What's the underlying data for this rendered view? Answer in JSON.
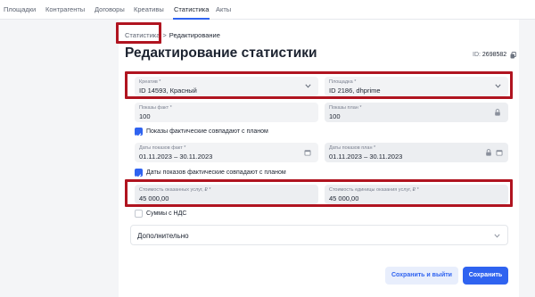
{
  "nav": {
    "items": [
      "Площадки",
      "Контрагенты",
      "Договоры",
      "Креативы",
      "Статистика",
      "Акты"
    ],
    "active_index": 4
  },
  "breadcrumb": {
    "parent": "Статистика",
    "separator": ">",
    "current": "Редактирование"
  },
  "page": {
    "title": "Редактирование статистики",
    "id_label": "ID:",
    "id_value": "2698582"
  },
  "fields": {
    "creative": {
      "label": "Креатив *",
      "value": "ID 14593, Красный"
    },
    "platform": {
      "label": "Площадка *",
      "value": "ID 2186, dhprime"
    },
    "impressions_fact": {
      "label": "Показы факт *",
      "value": "100"
    },
    "impressions_plan": {
      "label": "Показы план *",
      "value": "100"
    },
    "dates_fact": {
      "label": "Даты показов факт *",
      "value": "01.11.2023 – 30.11.2023"
    },
    "dates_plan": {
      "label": "Даты показов план *",
      "value": "01.11.2023 – 30.11.2023"
    },
    "cost_services": {
      "label": "Стоимость оказанных услуг, ₽ *",
      "value": "45 000,00"
    },
    "cost_unit": {
      "label": "Стоимость единицы оказания услуг, ₽ *",
      "value": "45 000,00"
    }
  },
  "checkboxes": {
    "impressions_match": {
      "label": "Показы фактические совпадают с планом",
      "checked": true
    },
    "dates_match": {
      "label": "Даты показов фактические совпадают с планом",
      "checked": true
    },
    "vat": {
      "label": "Суммы с НДС",
      "checked": false
    }
  },
  "accordion": {
    "label": "Дополнительно"
  },
  "buttons": {
    "save_exit": "Сохранить и выйти",
    "save": "Сохранить"
  },
  "colors": {
    "accent": "#2f63f0",
    "highlight": "#b01420"
  }
}
